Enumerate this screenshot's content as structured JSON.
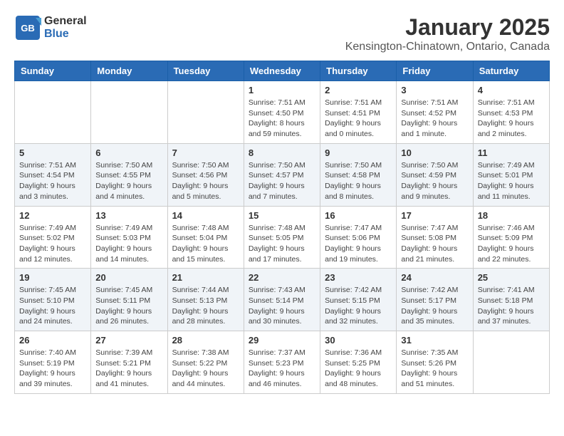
{
  "header": {
    "logo_general": "General",
    "logo_blue": "Blue",
    "month_title": "January 2025",
    "location": "Kensington-Chinatown, Ontario, Canada"
  },
  "weekdays": [
    "Sunday",
    "Monday",
    "Tuesday",
    "Wednesday",
    "Thursday",
    "Friday",
    "Saturday"
  ],
  "weeks": [
    [
      {
        "day": "",
        "info": ""
      },
      {
        "day": "",
        "info": ""
      },
      {
        "day": "",
        "info": ""
      },
      {
        "day": "1",
        "info": "Sunrise: 7:51 AM\nSunset: 4:50 PM\nDaylight: 8 hours and 59 minutes."
      },
      {
        "day": "2",
        "info": "Sunrise: 7:51 AM\nSunset: 4:51 PM\nDaylight: 9 hours and 0 minutes."
      },
      {
        "day": "3",
        "info": "Sunrise: 7:51 AM\nSunset: 4:52 PM\nDaylight: 9 hours and 1 minute."
      },
      {
        "day": "4",
        "info": "Sunrise: 7:51 AM\nSunset: 4:53 PM\nDaylight: 9 hours and 2 minutes."
      }
    ],
    [
      {
        "day": "5",
        "info": "Sunrise: 7:51 AM\nSunset: 4:54 PM\nDaylight: 9 hours and 3 minutes."
      },
      {
        "day": "6",
        "info": "Sunrise: 7:50 AM\nSunset: 4:55 PM\nDaylight: 9 hours and 4 minutes."
      },
      {
        "day": "7",
        "info": "Sunrise: 7:50 AM\nSunset: 4:56 PM\nDaylight: 9 hours and 5 minutes."
      },
      {
        "day": "8",
        "info": "Sunrise: 7:50 AM\nSunset: 4:57 PM\nDaylight: 9 hours and 7 minutes."
      },
      {
        "day": "9",
        "info": "Sunrise: 7:50 AM\nSunset: 4:58 PM\nDaylight: 9 hours and 8 minutes."
      },
      {
        "day": "10",
        "info": "Sunrise: 7:50 AM\nSunset: 4:59 PM\nDaylight: 9 hours and 9 minutes."
      },
      {
        "day": "11",
        "info": "Sunrise: 7:49 AM\nSunset: 5:01 PM\nDaylight: 9 hours and 11 minutes."
      }
    ],
    [
      {
        "day": "12",
        "info": "Sunrise: 7:49 AM\nSunset: 5:02 PM\nDaylight: 9 hours and 12 minutes."
      },
      {
        "day": "13",
        "info": "Sunrise: 7:49 AM\nSunset: 5:03 PM\nDaylight: 9 hours and 14 minutes."
      },
      {
        "day": "14",
        "info": "Sunrise: 7:48 AM\nSunset: 5:04 PM\nDaylight: 9 hours and 15 minutes."
      },
      {
        "day": "15",
        "info": "Sunrise: 7:48 AM\nSunset: 5:05 PM\nDaylight: 9 hours and 17 minutes."
      },
      {
        "day": "16",
        "info": "Sunrise: 7:47 AM\nSunset: 5:06 PM\nDaylight: 9 hours and 19 minutes."
      },
      {
        "day": "17",
        "info": "Sunrise: 7:47 AM\nSunset: 5:08 PM\nDaylight: 9 hours and 21 minutes."
      },
      {
        "day": "18",
        "info": "Sunrise: 7:46 AM\nSunset: 5:09 PM\nDaylight: 9 hours and 22 minutes."
      }
    ],
    [
      {
        "day": "19",
        "info": "Sunrise: 7:45 AM\nSunset: 5:10 PM\nDaylight: 9 hours and 24 minutes."
      },
      {
        "day": "20",
        "info": "Sunrise: 7:45 AM\nSunset: 5:11 PM\nDaylight: 9 hours and 26 minutes."
      },
      {
        "day": "21",
        "info": "Sunrise: 7:44 AM\nSunset: 5:13 PM\nDaylight: 9 hours and 28 minutes."
      },
      {
        "day": "22",
        "info": "Sunrise: 7:43 AM\nSunset: 5:14 PM\nDaylight: 9 hours and 30 minutes."
      },
      {
        "day": "23",
        "info": "Sunrise: 7:42 AM\nSunset: 5:15 PM\nDaylight: 9 hours and 32 minutes."
      },
      {
        "day": "24",
        "info": "Sunrise: 7:42 AM\nSunset: 5:17 PM\nDaylight: 9 hours and 35 minutes."
      },
      {
        "day": "25",
        "info": "Sunrise: 7:41 AM\nSunset: 5:18 PM\nDaylight: 9 hours and 37 minutes."
      }
    ],
    [
      {
        "day": "26",
        "info": "Sunrise: 7:40 AM\nSunset: 5:19 PM\nDaylight: 9 hours and 39 minutes."
      },
      {
        "day": "27",
        "info": "Sunrise: 7:39 AM\nSunset: 5:21 PM\nDaylight: 9 hours and 41 minutes."
      },
      {
        "day": "28",
        "info": "Sunrise: 7:38 AM\nSunset: 5:22 PM\nDaylight: 9 hours and 44 minutes."
      },
      {
        "day": "29",
        "info": "Sunrise: 7:37 AM\nSunset: 5:23 PM\nDaylight: 9 hours and 46 minutes."
      },
      {
        "day": "30",
        "info": "Sunrise: 7:36 AM\nSunset: 5:25 PM\nDaylight: 9 hours and 48 minutes."
      },
      {
        "day": "31",
        "info": "Sunrise: 7:35 AM\nSunset: 5:26 PM\nDaylight: 9 hours and 51 minutes."
      },
      {
        "day": "",
        "info": ""
      }
    ]
  ]
}
